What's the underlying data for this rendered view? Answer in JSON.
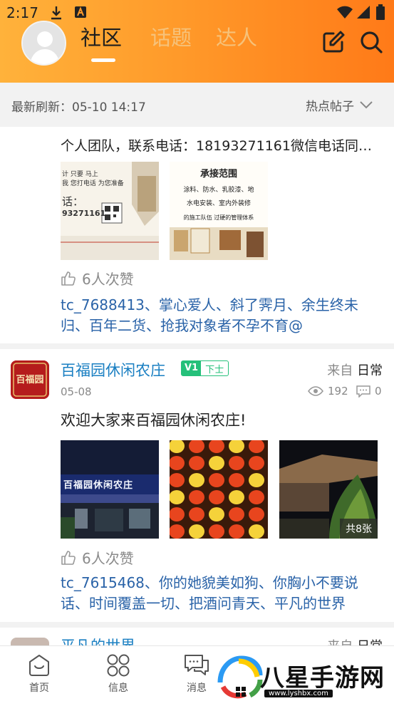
{
  "status_bar": {
    "time": "2:17"
  },
  "tabs": [
    {
      "label": "社区",
      "active": true
    },
    {
      "label": "话题",
      "active": false
    },
    {
      "label": "达人",
      "active": false
    }
  ],
  "refresh_bar": {
    "text": "最新刷新：05-10 14:17",
    "sort_label": "热点帖子"
  },
  "posts": [
    {
      "text": "个人团队，联系电话：18193271161微信电话同…",
      "images": [
        {
          "lines": [
            "计 只要 马上",
            "我 您打电话 为您准备",
            "话：",
            "93271161"
          ]
        },
        {
          "lines": [
            "承接范围",
            "涂料、防水、乳胶漆、地",
            "水电安装、室内外装修",
            "的施工队伍 过硬的管理体系"
          ]
        }
      ],
      "likes": "6人次赞",
      "likers": "tc_7688413、掌心爱人、斜了霁月、余生终未归、百年二货、抢我对象者不孕不育@"
    },
    {
      "avatar_text": "百福园",
      "author": "百福园休闲农庄",
      "level_badge": "V1",
      "rank_badge": "下士",
      "source_prefix": "来自",
      "source_category": "日常",
      "date": "05-08",
      "views": "192",
      "comments": "0",
      "text": "欢迎大家来百福园休闲农庄!",
      "images": [
        {
          "sign": "百福园休闲农庄"
        },
        {},
        {
          "count_badge": "共8张"
        }
      ],
      "likes": "6人次赞",
      "likers": "tc_7615468、你的她貌美如狗、你胸小不要说话、时间覆盖一切、把酒问青天、平凡的世界"
    },
    {
      "author": "平凡的世界",
      "source_prefix": "来自",
      "source_category": "日常"
    }
  ],
  "bottom_nav": [
    {
      "label": "首页",
      "icon": "home-icon"
    },
    {
      "label": "信息",
      "icon": "grid-icon"
    },
    {
      "label": "消息",
      "icon": "chat-icon"
    }
  ],
  "watermark": {
    "text": "八星手游网",
    "url": "www.lyshbx.com"
  },
  "colors": {
    "header_orange": "#ff8a20",
    "link_blue": "#2a63a8",
    "author_blue": "#1a7fc2"
  }
}
